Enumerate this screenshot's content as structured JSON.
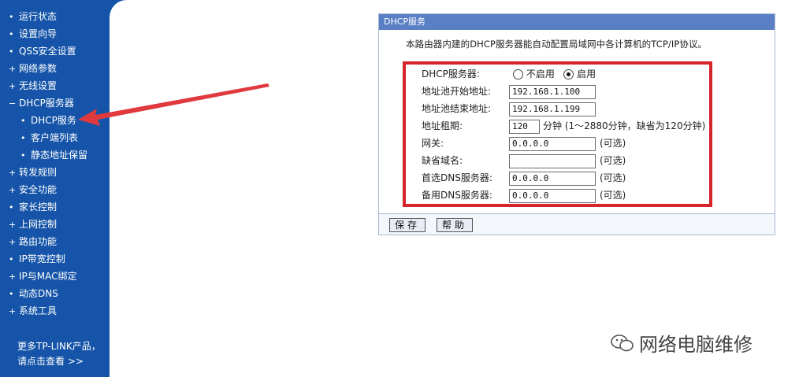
{
  "sidebar": {
    "items": [
      {
        "label": "运行状态",
        "bullet": "•",
        "sub": false
      },
      {
        "label": "设置向导",
        "bullet": "•",
        "sub": false
      },
      {
        "label": "QSS安全设置",
        "bullet": "•",
        "sub": false
      },
      {
        "label": "网络参数",
        "bullet": "+",
        "sub": false
      },
      {
        "label": "无线设置",
        "bullet": "+",
        "sub": false
      },
      {
        "label": "DHCP服务器",
        "bullet": "−",
        "sub": false
      },
      {
        "label": "DHCP服务",
        "bullet": "•",
        "sub": true
      },
      {
        "label": "客户端列表",
        "bullet": "•",
        "sub": true
      },
      {
        "label": "静态地址保留",
        "bullet": "•",
        "sub": true
      },
      {
        "label": "转发规则",
        "bullet": "+",
        "sub": false
      },
      {
        "label": "安全功能",
        "bullet": "+",
        "sub": false
      },
      {
        "label": "家长控制",
        "bullet": "•",
        "sub": false
      },
      {
        "label": "上网控制",
        "bullet": "+",
        "sub": false
      },
      {
        "label": "路由功能",
        "bullet": "+",
        "sub": false
      },
      {
        "label": "IP带宽控制",
        "bullet": "•",
        "sub": false
      },
      {
        "label": "IP与MAC绑定",
        "bullet": "+",
        "sub": false
      },
      {
        "label": "动态DNS",
        "bullet": "•",
        "sub": false
      },
      {
        "label": "系统工具",
        "bullet": "+",
        "sub": false
      }
    ],
    "promo_line1": "更多TP-LINK产品，",
    "promo_line2": "请点击查看 >>"
  },
  "panel": {
    "title": "DHCP服务",
    "description": "本路由器内建的DHCP服务器能自动配置局域网中各计算机的TCP/IP协议。",
    "dhcp_server_label": "DHCP服务器:",
    "option_disable": "不启用",
    "option_enable": "启用",
    "selected": "enable",
    "start_label": "地址池开始地址:",
    "start_value": "192.168.1.100",
    "end_label": "地址池结束地址:",
    "end_value": "192.168.1.199",
    "lease_label": "地址租期:",
    "lease_value": "120",
    "lease_hint": "分钟 (1～2880分钟，缺省为120分钟)",
    "gateway_label": "网关:",
    "gateway_value": "0.0.0.0",
    "optional": "(可选)",
    "domain_label": "缺省域名:",
    "domain_value": "",
    "dns1_label": "首选DNS服务器:",
    "dns1_value": "0.0.0.0",
    "dns2_label": "备用DNS服务器:",
    "dns2_value": "0.0.0.0",
    "save_label": "保存",
    "help_label": "帮助"
  },
  "watermark": "网络电脑维修",
  "colors": {
    "sidebar": "#1554a8",
    "panel_title": "#5a7fc5",
    "highlight": "#d7232b"
  }
}
